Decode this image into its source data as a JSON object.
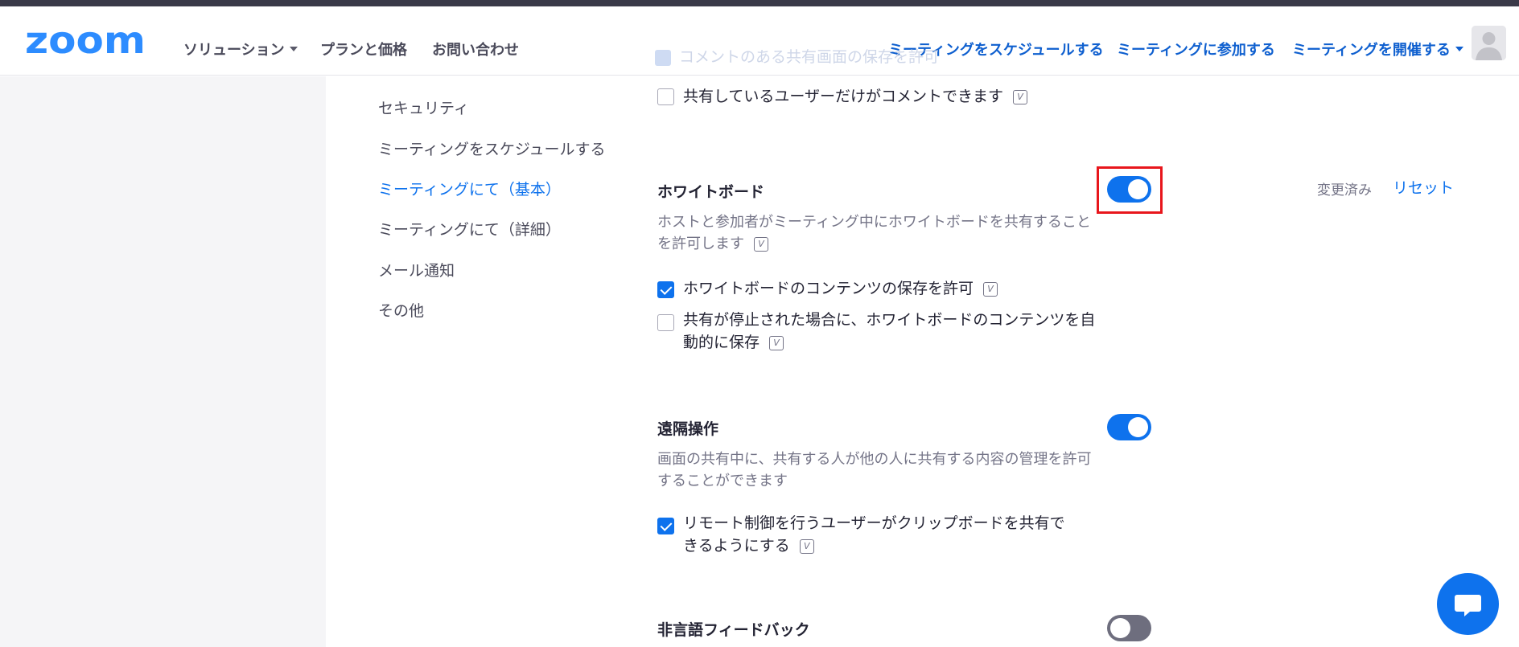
{
  "header": {
    "logo_text": "zoom",
    "nav_left": [
      {
        "label": "ソリューション",
        "has_dropdown": true
      },
      {
        "label": "プランと価格",
        "has_dropdown": false
      },
      {
        "label": "お問い合わせ",
        "has_dropdown": false
      }
    ],
    "nav_right": [
      {
        "label": "ミーティングをスケジュールする",
        "has_dropdown": false
      },
      {
        "label": "ミーティングに参加する",
        "has_dropdown": false
      },
      {
        "label": "ミーティングを開催する",
        "has_dropdown": true
      }
    ],
    "avatar_icon": "user-avatar-icon"
  },
  "ghost_text": "コメントのある共有画面の保存を許可",
  "sidebar": {
    "items": [
      {
        "label": "セキュリティ",
        "active": false
      },
      {
        "label": "ミーティングをスケジュールする",
        "active": false
      },
      {
        "label": "ミーティングにて（基本）",
        "active": true
      },
      {
        "label": "ミーティングにて（詳細）",
        "active": false
      },
      {
        "label": "メール通知",
        "active": false
      },
      {
        "label": "その他",
        "active": false
      }
    ]
  },
  "content": {
    "comment_option": {
      "label": "共有しているユーザーだけがコメントできます",
      "checked": false
    },
    "whiteboard": {
      "title": "ホワイトボード",
      "toggle_on": true,
      "description": "ホストと参加者がミーティング中にホワイトボードを共有することを許可します",
      "status": "変更済み",
      "reset_label": "リセット",
      "options": [
        {
          "label": "ホワイトボードのコンテンツの保存を許可",
          "checked": true
        },
        {
          "label": "共有が停止された場合に、ホワイトボードのコンテンツを自動的に保存",
          "checked": false
        }
      ]
    },
    "remote_control": {
      "title": "遠隔操作",
      "toggle_on": true,
      "description": "画面の共有中に、共有する人が他の人に共有する内容の管理を許可することができます",
      "options": [
        {
          "label": "リモート制御を行うユーザーがクリップボードを共有できるようにする",
          "checked": true
        }
      ]
    },
    "nonverbal_feedback": {
      "title": "非言語フィードバック",
      "toggle_on": false
    }
  },
  "info_icon_text": "V",
  "colors": {
    "brand_blue": "#0e72ed",
    "nav_blue": "#0e5fcf",
    "highlight_red": "#e8161c",
    "toggle_off": "#6e6e7e"
  }
}
